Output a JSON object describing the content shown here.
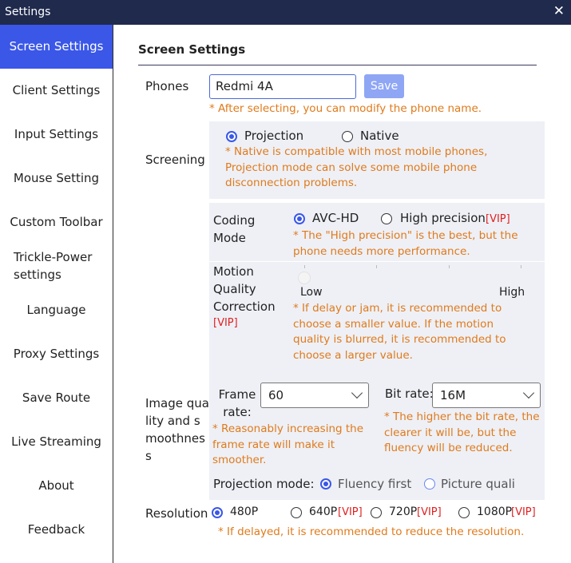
{
  "window": {
    "title": "Settings"
  },
  "sidebar": {
    "items": [
      {
        "label": "Screen Settings"
      },
      {
        "label": "Client Settings"
      },
      {
        "label": "Input Settings"
      },
      {
        "label": "Mouse Setting"
      },
      {
        "label": "Custom Toolbar"
      },
      {
        "label": "Trickle-Power settings"
      },
      {
        "label": "Language"
      },
      {
        "label": "Proxy Settings"
      },
      {
        "label": "Save Route"
      },
      {
        "label": "Live Streaming"
      },
      {
        "label": "About"
      },
      {
        "label": "Feedback"
      }
    ]
  },
  "main": {
    "title": "Screen Settings",
    "phones": {
      "label": "Phones",
      "value": "Redmi 4A",
      "save": "Save",
      "note": "* After selecting, you can modify the phone name."
    },
    "screening": {
      "label": "Screening",
      "options": [
        "Projection",
        "Native"
      ],
      "selected": "Projection",
      "note": "* Native is compatible with most mobile phones, Projection mode can solve some mobile phone disconnection problems."
    },
    "coding": {
      "label": "Coding Mode",
      "options": [
        "AVC-HD",
        "High precision"
      ],
      "vip": "[VIP]",
      "selected": "AVC-HD",
      "note": "* The \"High precision\" is the best, but the phone needs more performance."
    },
    "motion": {
      "label": "Motion Quality Correction",
      "vip": "[VIP]",
      "low": "Low",
      "high": "High",
      "value": 0,
      "note": "* If delay or jam, it is recommended to choose a smaller value. If the motion quality is blurred, it is recommended to choose a larger value."
    },
    "image": {
      "label": "Image quality and smoothness",
      "frame_rate": {
        "label": "Frame rate:",
        "value": "60",
        "note": "* Reasonably increasing the frame rate will make it smoother."
      },
      "bit_rate": {
        "label": "Bit rate:",
        "value": "16M",
        "note": "* The higher the bit rate, the clearer it will be, but the fluency will be reduced."
      },
      "projection_mode": {
        "label": "Projection mode:",
        "options": [
          "Fluency first",
          "Picture quali"
        ],
        "selected": "Fluency first"
      }
    },
    "resolution": {
      "label": "Resolution",
      "options": [
        "480P",
        "640P",
        "720P",
        "1080P"
      ],
      "vip": "[VIP]",
      "selected": "480P",
      "note": "* If delayed, it is recommended to reduce the resolution."
    }
  },
  "colors": {
    "titlebar": "#1f2a4d",
    "accent": "#3a57e8",
    "note": "#e07a1b",
    "vip": "#e02020",
    "panel": "#eef0f6"
  }
}
